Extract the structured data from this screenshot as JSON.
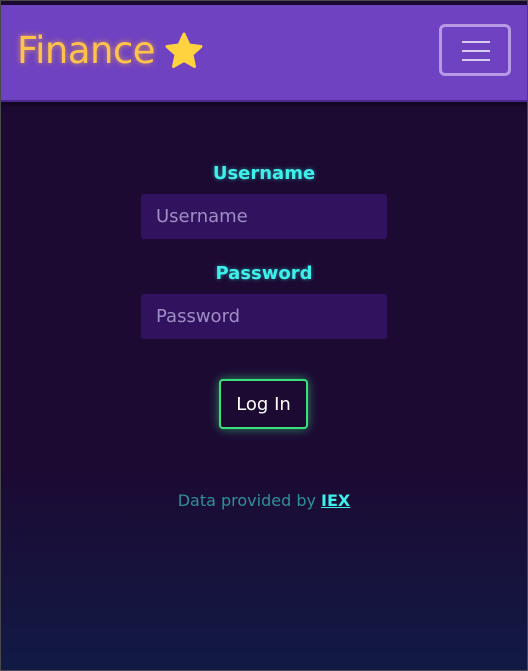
{
  "navbar": {
    "brand": "Finance",
    "brand_icon": "star-icon",
    "toggler_icon": "hamburger-menu-icon",
    "color": "#6f42c1"
  },
  "form": {
    "username_label": "Username",
    "username_placeholder": "Username",
    "username_value": "",
    "password_label": "Password",
    "password_placeholder": "Password",
    "password_value": "",
    "submit_label": "Log In"
  },
  "footer": {
    "credit_text": "Data provided by ",
    "credit_link": "IEX"
  },
  "colors": {
    "background": "#1c0a33",
    "accent_cyan": "#3ef0ea",
    "accent_green": "#39e07a",
    "brand_gold": "#ffc24a"
  }
}
